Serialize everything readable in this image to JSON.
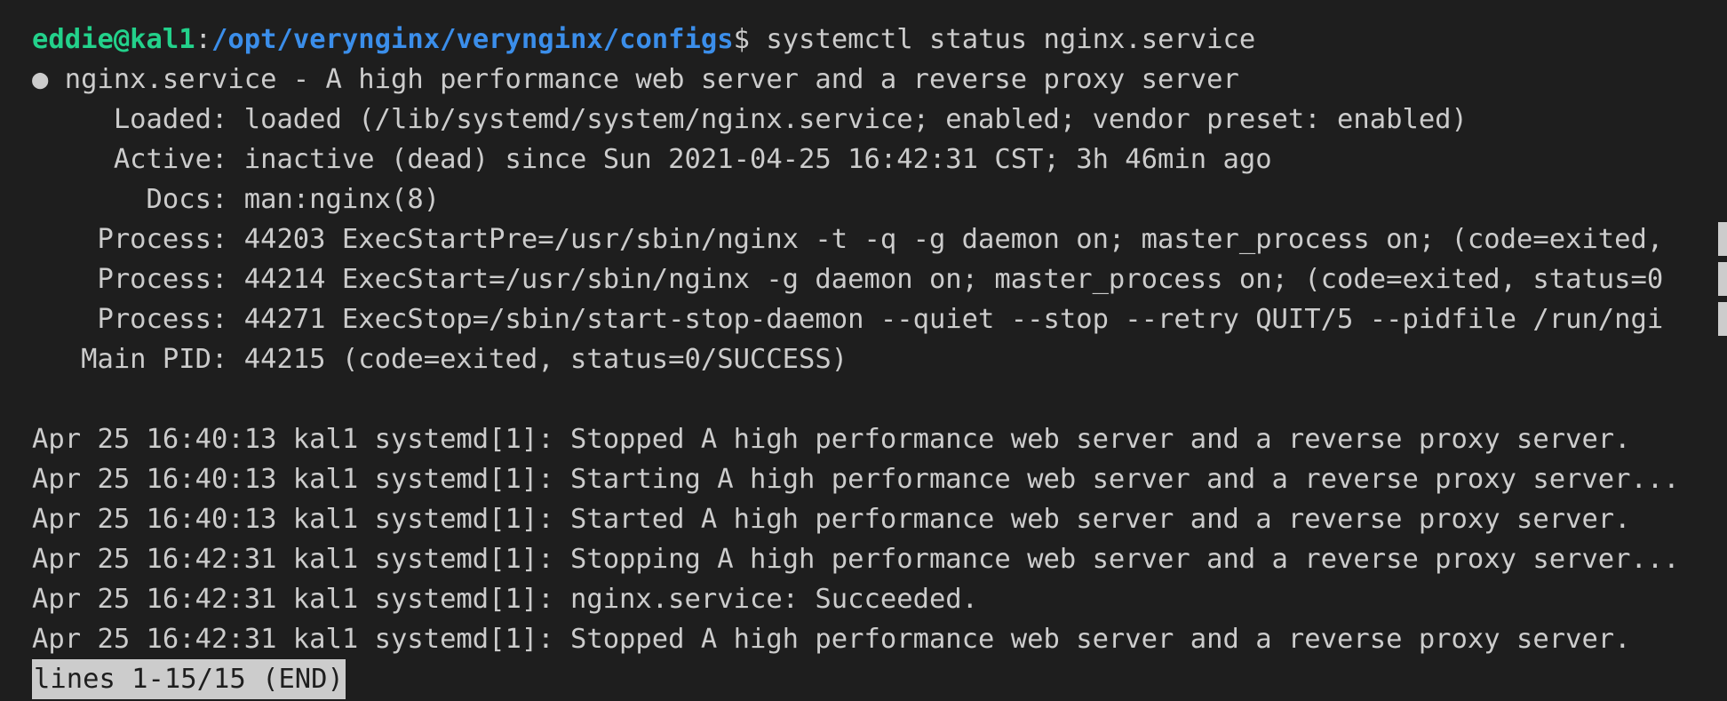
{
  "prompt": {
    "user_host": "eddie@kal1",
    "separator": ":",
    "path": "/opt/verynginx/verynginx/configs",
    "symbol": "$",
    "command": " systemctl status nginx.service"
  },
  "status": {
    "header": "● nginx.service - A high performance web server and a reverse proxy server",
    "loaded": "     Loaded: loaded (/lib/systemd/system/nginx.service; enabled; vendor preset: enabled)",
    "active": "     Active: inactive (dead) since Sun 2021-04-25 16:42:31 CST; 3h 46min ago",
    "docs": "       Docs: man:nginx(8)",
    "process_1": "    Process: 44203 ExecStartPre=/usr/sbin/nginx -t -q -g daemon on; master_process on; (code=exited,",
    "process_2": "    Process: 44214 ExecStart=/usr/sbin/nginx -g daemon on; master_process on; (code=exited, status=0",
    "process_3": "    Process: 44271 ExecStop=/sbin/start-stop-daemon --quiet --stop --retry QUIT/5 --pidfile /run/ngi",
    "main_pid": "   Main PID: 44215 (code=exited, status=0/SUCCESS)"
  },
  "logs": [
    "Apr 25 16:40:13 kal1 systemd[1]: Stopped A high performance web server and a reverse proxy server.",
    "Apr 25 16:40:13 kal1 systemd[1]: Starting A high performance web server and a reverse proxy server...",
    "Apr 25 16:40:13 kal1 systemd[1]: Started A high performance web server and a reverse proxy server.",
    "Apr 25 16:42:31 kal1 systemd[1]: Stopping A high performance web server and a reverse proxy server...",
    "Apr 25 16:42:31 kal1 systemd[1]: nginx.service: Succeeded.",
    "Apr 25 16:42:31 kal1 systemd[1]: Stopped A high performance web server and a reverse proxy server."
  ],
  "pager": {
    "status": "lines 1-15/15 (END)"
  },
  "colors": {
    "background": "#1e1e1e",
    "foreground": "#cccccc",
    "user_host": "#23d18b",
    "path": "#3b8eea"
  }
}
